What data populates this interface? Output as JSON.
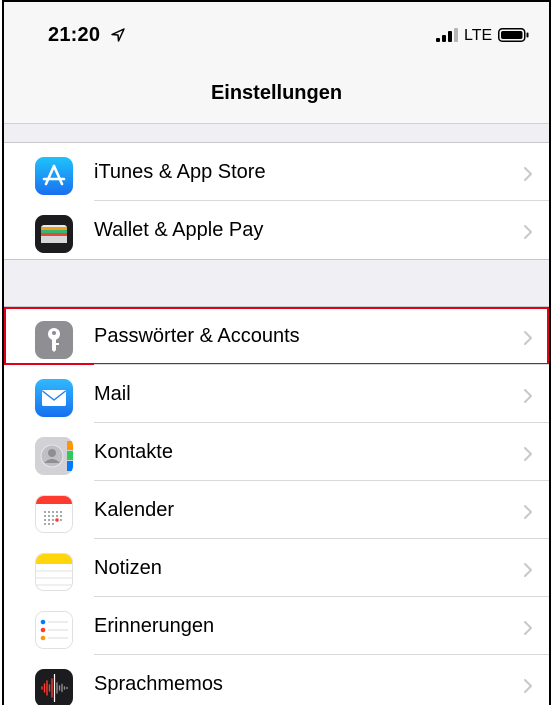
{
  "status_bar": {
    "time": "21:20",
    "network": "LTE",
    "icons": [
      "location-arrow-icon",
      "signal-bars-icon",
      "battery-icon"
    ]
  },
  "nav": {
    "title": "Einstellungen"
  },
  "groups": [
    {
      "items": [
        {
          "label": "iTunes & App Store",
          "icon": "app-store-icon",
          "icon_color": "#1a8cf0"
        },
        {
          "label": "Wallet & Apple Pay",
          "icon": "wallet-icon",
          "icon_color": "#1c1c1e"
        }
      ]
    },
    {
      "items": [
        {
          "label": "Passwörter & Accounts",
          "icon": "key-icon",
          "icon_color": "#8e8e93",
          "highlighted": true
        },
        {
          "label": "Mail",
          "icon": "mail-icon",
          "icon_color": "#2196f3"
        },
        {
          "label": "Kontakte",
          "icon": "contacts-icon",
          "icon_color": "#c7c7cc"
        },
        {
          "label": "Kalender",
          "icon": "calendar-icon",
          "icon_color": "#ffffff"
        },
        {
          "label": "Notizen",
          "icon": "notes-icon",
          "icon_color": "#ffd60a"
        },
        {
          "label": "Erinnerungen",
          "icon": "reminders-icon",
          "icon_color": "#ffffff"
        },
        {
          "label": "Sprachmemos",
          "icon": "voice-memos-icon",
          "icon_color": "#1c1c1e"
        }
      ]
    }
  ],
  "colors": {
    "highlight_border": "#e0001a",
    "background": "#efeff4",
    "chevron": "#c7c7cc"
  }
}
